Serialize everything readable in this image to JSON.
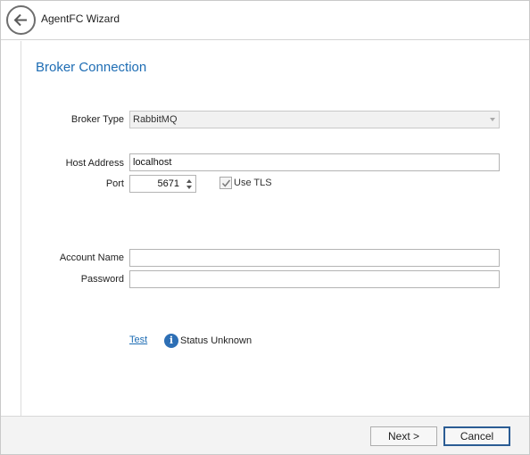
{
  "window": {
    "title": "AgentFC Wizard"
  },
  "page": {
    "heading": "Broker Connection"
  },
  "form": {
    "broker_type": {
      "label": "Broker Type",
      "value": "RabbitMQ"
    },
    "host_address": {
      "label": "Host Address",
      "value": "localhost"
    },
    "port": {
      "label": "Port",
      "value": "5671"
    },
    "use_tls": {
      "label": "Use TLS",
      "checked": true
    },
    "account_name": {
      "label": "Account Name",
      "value": ""
    },
    "password": {
      "label": "Password",
      "value": ""
    }
  },
  "test": {
    "link_label": "Test",
    "status_icon": "info-icon",
    "status_text": "Status Unknown"
  },
  "footer": {
    "next_label": "Next >",
    "cancel_label": "Cancel"
  },
  "colors": {
    "accent": "#1e6db4",
    "info_icon": "#2d6fb5",
    "default_button_border": "#2b5c94"
  }
}
